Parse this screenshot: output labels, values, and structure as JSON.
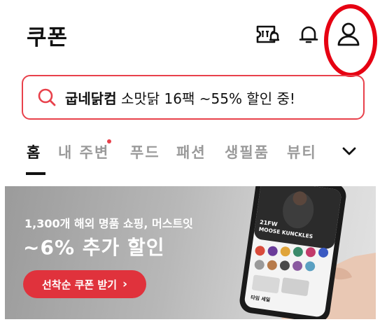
{
  "header": {
    "title": "쿠폰",
    "icons": [
      "coupon-icon",
      "bell-icon",
      "user-icon"
    ]
  },
  "search": {
    "icon": "search-icon",
    "brand": "굽네닭컴",
    "text": "소맛닭 16팩 ~55% 할인 중!"
  },
  "tabs": [
    {
      "label": "홈",
      "active": true
    },
    {
      "label": "내 주변",
      "badge": true
    },
    {
      "label": "푸드"
    },
    {
      "label": "패션"
    },
    {
      "label": "생필품"
    },
    {
      "label": "뷰티"
    }
  ],
  "banner": {
    "line1": "1,300개 해외 명품 쇼핑, 머스트잇",
    "line2": "~6% 추가 할인",
    "button": "선착순 쿠폰 받기",
    "phone_heading": "21FW MOOSE KUNCKLES",
    "phone_section": "타임 세일"
  },
  "colors": {
    "accent": "#e8414b",
    "annotation": "#e60012",
    "banner_button": "#e0323c"
  }
}
